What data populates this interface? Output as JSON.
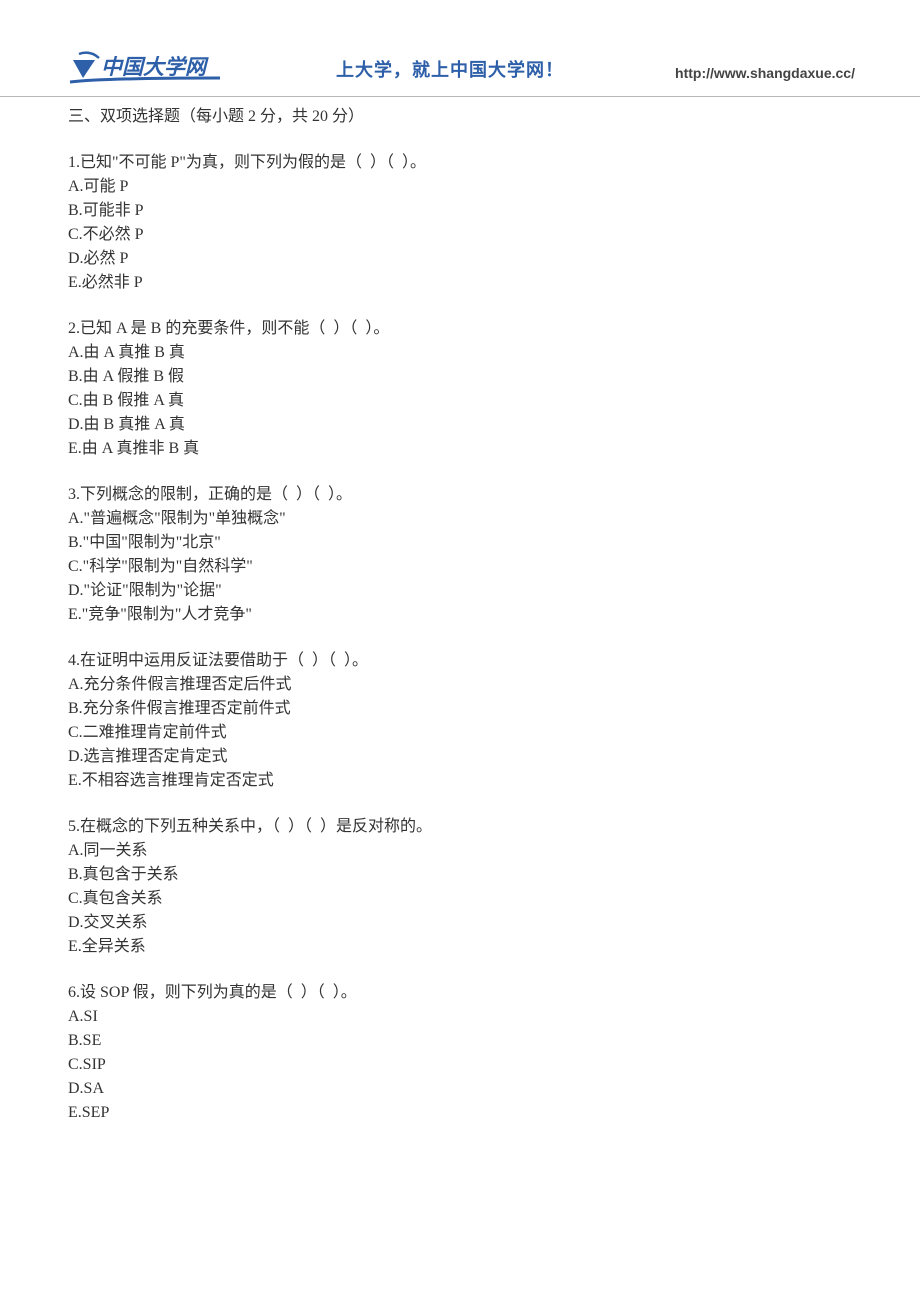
{
  "header": {
    "logo_text": "中国大学网",
    "slogan": "上大学，就上中国大学网！",
    "url": "http://www.shangdaxue.cc/"
  },
  "section_title": "三、双项选择题（每小题 2 分，共 20 分）",
  "questions": [
    {
      "stem": "1.已知\"不可能 P\"为真，则下列为假的是（  ）（  ）。",
      "options": [
        "A.可能 P",
        "B.可能非 P",
        "C.不必然 P",
        "D.必然 P",
        "E.必然非 P"
      ]
    },
    {
      "stem": "2.已知 A 是 B 的充要条件，则不能（  ）（  ）。",
      "options": [
        "A.由 A 真推 B 真",
        "B.由 A 假推 B 假",
        "C.由 B 假推 A 真",
        "D.由 B 真推 A 真",
        "E.由 A 真推非 B 真"
      ]
    },
    {
      "stem": "3.下列概念的限制，正确的是（  ）（  ）。",
      "options": [
        "A.\"普遍概念\"限制为\"单独概念\"",
        "B.\"中国\"限制为\"北京\"",
        "C.\"科学\"限制为\"自然科学\"",
        "D.\"论证\"限制为\"论据\"",
        "E.\"竞争\"限制为\"人才竞争\""
      ]
    },
    {
      "stem": "4.在证明中运用反证法要借助于（  ）（  ）。",
      "options": [
        "A.充分条件假言推理否定后件式",
        "B.充分条件假言推理否定前件式",
        "C.二难推理肯定前件式",
        "D.选言推理否定肯定式",
        "E.不相容选言推理肯定否定式"
      ]
    },
    {
      "stem": "5.在概念的下列五种关系中，（  ）（  ）是反对称的。",
      "options": [
        "A.同一关系",
        "B.真包含于关系",
        "C.真包含关系",
        "D.交叉关系",
        "E.全异关系"
      ]
    },
    {
      "stem": "6.设 SOP 假，则下列为真的是（  ）（  ）。",
      "options": [
        "A.SI",
        "B.SE",
        "C.SIP",
        "D.SA",
        "E.SEP"
      ]
    }
  ]
}
